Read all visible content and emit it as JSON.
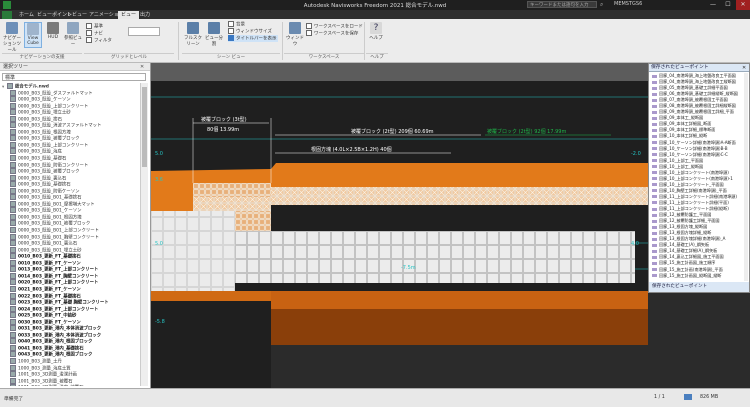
{
  "window": {
    "title": "Autodesk Navisworks Freedom 2021   総合モデル.nwd",
    "search_placeholder": "キーワードまたは語句を入力",
    "user": "MEMSTGS6",
    "min": "—",
    "max": "☐",
    "close": "✕"
  },
  "tabs": [
    "ホーム",
    "ビューポイント",
    "レビュー",
    "アニメーション",
    "ビュー",
    "出力"
  ],
  "active_tab": 4,
  "ribbon": {
    "nav_tools": [
      "ナビゲーションツール",
      "View Cube",
      "HUD",
      "参照ビュー"
    ],
    "chk_tools": [
      "基準",
      "ナビ",
      "フィルタ"
    ],
    "group_nav": "ナビゲーションの支援",
    "group_grid": "グリッドとレベル",
    "screen_btns": [
      "フルスクリーン",
      "ビュー分割"
    ],
    "screen_checks": [
      "背景",
      "ウィンドウサイズ",
      "タイトルバーを表示"
    ],
    "group_scene": "シーン ビュー",
    "workspace_btn": "ウィンドウ",
    "workspace_items": [
      "ワークスペースをロード",
      "ワークスペースを保存"
    ],
    "group_workspace": "ワークスペース",
    "help_btn": "ヘルプ",
    "group_help": "ヘルプ"
  },
  "left_panel": {
    "title": "選択ツリー",
    "mode": "標準",
    "root": "総合モデル.nwd",
    "items": [
      {
        "t": "0000_B03_既設_ダスファルトマット",
        "b": false
      },
      {
        "t": "0000_B03_既設_ケーソン",
        "b": false
      },
      {
        "t": "0000_B03_既設_上部コンクリート",
        "b": false
      },
      {
        "t": "0000_B03_既設_埋立土砂",
        "b": false
      },
      {
        "t": "0000_B03_既設_捨石",
        "b": false
      },
      {
        "t": "0000_B03_既設_消波アスファルトマット",
        "b": false
      },
      {
        "t": "0000_B03_既設_根固方塊",
        "b": false
      },
      {
        "t": "0000_B03_既設_被覆ブロック",
        "b": false
      },
      {
        "t": "0000_B03_既設_上部コンクリート",
        "b": false
      },
      {
        "t": "0000_B03_既設_海底",
        "b": false
      },
      {
        "t": "0000_B03_既設_基礎石",
        "b": false
      },
      {
        "t": "0000_B03_既設_防衛コンクリート",
        "b": false
      },
      {
        "t": "0000_B03_既設_被覆ブロック",
        "b": false
      },
      {
        "t": "0000_B03_既設_裏込石",
        "b": false
      },
      {
        "t": "0000_B03_既設_基礎捨石",
        "b": false
      },
      {
        "t": "0000_B03_既設_防衛ケーソン",
        "b": false
      },
      {
        "t": "0000_B03_既設_B01_基礎捨石",
        "b": false
      },
      {
        "t": "0000_B03_既設_B01_摩擦増大マット",
        "b": false
      },
      {
        "t": "0000_B03_既設_B01_ケーソン",
        "b": false
      },
      {
        "t": "0000_B03_既設_B01_根固方塊",
        "b": false
      },
      {
        "t": "0000_B03_既設_B01_被覆ブロック",
        "b": false
      },
      {
        "t": "0000_B03_既設_B01_上部コンクリート",
        "b": false
      },
      {
        "t": "0000_B03_既設_B01_胸壁コンクリート",
        "b": false
      },
      {
        "t": "0000_B03_既設_B01_裏込石",
        "b": false
      },
      {
        "t": "0000_B03_既設_B01_埋立土砂",
        "b": false
      },
      {
        "t": "0010_B03_更新_FT_基礎捨石",
        "b": true
      },
      {
        "t": "0010_B03_更新_FT_ケーソン",
        "b": true
      },
      {
        "t": "0013_B03_更新_FT_上部コンクリート",
        "b": true
      },
      {
        "t": "0014_B03_更新_FT_胸壁コンクリート",
        "b": true
      },
      {
        "t": "0020_B03_更新_FT_上部コンクリート",
        "b": true
      },
      {
        "t": "0021_B03_更新_FT_ケーソン",
        "b": true
      },
      {
        "t": "0022_B03_更新_FT_基礎捨石",
        "b": true
      },
      {
        "t": "0023_B03_更新_FT_基礎 胸壁コンクリート",
        "b": true
      },
      {
        "t": "0024_B03_更新_FT_上部コンクリート",
        "b": true
      },
      {
        "t": "0025_B03_更新_FT_中詰砂",
        "b": true
      },
      {
        "t": "0030_B03_更新_FT_ケーソン",
        "b": true
      },
      {
        "t": "0031_B03_更新_港内_本体消波ブロック",
        "b": true
      },
      {
        "t": "0033_B03_更新_港内_本体消波ブロック",
        "b": true
      },
      {
        "t": "0040_B03_更新_港内_根固ブロック",
        "b": true
      },
      {
        "t": "0041_B03_更新_港内_基礎捨石",
        "b": true
      },
      {
        "t": "0043_B03_更新_港内_根固ブロック",
        "b": true
      },
      {
        "t": "1000_B03_測量_土丹",
        "b": false
      },
      {
        "t": "1000_B03_測量_海底土質",
        "b": false
      },
      {
        "t": "1001_B03_3D測量_浚渫計画",
        "b": false
      },
      {
        "t": "1001_B03_3D測量_被覆石",
        "b": false
      },
      {
        "t": "1001_B03_3D測量_港内_被覆石",
        "b": false
      },
      {
        "t": "1001_B03_測量_港内_ケーソン_根固ブロック",
        "b": false
      }
    ]
  },
  "viewport": {
    "labels": {
      "block_left": "被覆ブロック (3t型)",
      "block_left_count": "80個 13.99m",
      "block_center": "被覆ブロック (2t型)  209個 60.69m",
      "block_right": "被覆ブロック (2t型) 92個 17.99m",
      "foundation": "根固方塊 (4.0L×2.5B×1.2H) 40個",
      "lvl1": "5.0",
      "lvl2": "3.6",
      "lvl3": "5.0",
      "lvl4": "-7.5m",
      "lvl5": "-5.8",
      "lvl6": "-2.0",
      "lvl7": "4.0"
    },
    "colors": {
      "orange": "#e27a1a",
      "dark_orange": "#a8500f",
      "grid": "#d8d8d8",
      "cyan": "#26c4c4",
      "green": "#1fb84a"
    }
  },
  "right_panel": {
    "title": "保存されたビューポイント",
    "items": [
      "回廊_04_南港埠頭_海上地盤改良工平面図",
      "回廊_04_南港埠頭_海上地盤改良工縦断図",
      "回廊_05_南港埠頭_基礎工詳細平面図",
      "回廊_06_南港埠頭_基礎工詳細縦断_縦断図",
      "回廊_07_南港埠頭_被覆根固工平面図",
      "回廊_08_南港埠頭_被覆根固工詳細縦断図",
      "回廊_09_南港埠頭_被覆根固工詳細_平面",
      "回廊_09_本体工_縦断図",
      "回廊_09_本体工詳細図_断面",
      "回廊_09_本体工詳細_標準断面",
      "回廊_10_本体工詳細_縦断",
      "回廊_10_ケーソン詳細(南港埠頭)A-A断面",
      "回廊_10_ケーソン詳細(南港埠頭)B-B",
      "回廊_10_ケーソン詳細(南港埠頭)C-C",
      "回廊_10_上部工_平面図",
      "回廊_10_上部工_縦断図",
      "回廊_10_上部コンクリート(南港埠頭)",
      "回廊_10_上部コンクリート(南港埠頭)-1",
      "回廊_10_上部コンクリート_平面図",
      "回廊_10_胸壁工詳細(南港埠頭)_平面",
      "回廊_11_上部コンクリート詳細(南港埠頭)",
      "回廊_11_上部コンクリート詳細(平面)",
      "回廊_11_上部コンクリート詳細(縦断)",
      "回廊_12_被覆防護工_平面図",
      "回廊_12_被覆防護工詳細_平面図",
      "回廊_13_根固方塊_縦断図",
      "回廊_13_根固方塊詳細_縦断",
      "回廊_13_根固方塊詳細(南港埠頭)_A",
      "回廊_14_基礎工(A)_鋼矢板",
      "回廊_14_基礎工詳細(A)_鋼矢板",
      "回廊_14_裏込工詳細図_施工平面図",
      "回廊_15_施工計画図_施工順序",
      "回廊_15_施工計画(南港埠頭)_平面",
      "回廊_15_施工計画図_縦断図_縦断"
    ],
    "footer": "保存されたビューポイント"
  },
  "status": {
    "left": "準備完了",
    "page": "1 / 1",
    "mem": "826 MB"
  }
}
